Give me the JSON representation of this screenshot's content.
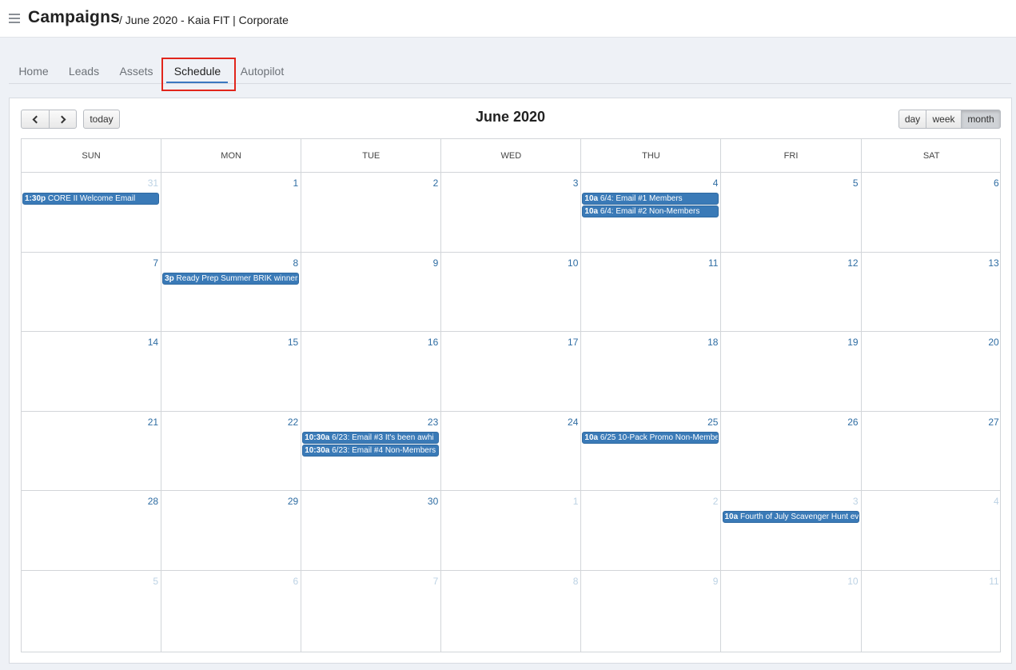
{
  "header": {
    "title": "Campaigns",
    "subtitle": "/ June 2020 - Kaia FIT | Corporate",
    "menu_icon": "hamburger-icon"
  },
  "tabs": [
    {
      "label": "Home"
    },
    {
      "label": "Leads"
    },
    {
      "label": "Assets"
    },
    {
      "label": "Schedule",
      "active": true
    },
    {
      "label": "Autopilot"
    }
  ],
  "toolbar": {
    "prev_icon": "chevron-left-icon",
    "next_icon": "chevron-right-icon",
    "today_label": "today",
    "title": "June 2020",
    "views": [
      "day",
      "week",
      "month"
    ],
    "active_view": "month"
  },
  "calendar": {
    "weekdays": [
      "SUN",
      "MON",
      "TUE",
      "WED",
      "THU",
      "FRI",
      "SAT"
    ],
    "weeks": [
      [
        {
          "day": "31",
          "other": true,
          "events": [
            {
              "time": "1:30p",
              "title": "CORE II Welcome Email"
            }
          ]
        },
        {
          "day": "1",
          "events": []
        },
        {
          "day": "2",
          "events": []
        },
        {
          "day": "3",
          "events": []
        },
        {
          "day": "4",
          "events": [
            {
              "time": "10a",
              "title": "6/4: Email #1 Members"
            },
            {
              "time": "10a",
              "title": "6/4: Email #2 Non-Members"
            }
          ]
        },
        {
          "day": "5",
          "events": []
        },
        {
          "day": "6",
          "events": []
        }
      ],
      [
        {
          "day": "7",
          "events": []
        },
        {
          "day": "8",
          "events": [
            {
              "time": "3p",
              "title": "Ready Prep Summer BRIK winners"
            }
          ]
        },
        {
          "day": "9",
          "events": []
        },
        {
          "day": "10",
          "events": []
        },
        {
          "day": "11",
          "events": []
        },
        {
          "day": "12",
          "events": []
        },
        {
          "day": "13",
          "events": []
        }
      ],
      [
        {
          "day": "14",
          "events": []
        },
        {
          "day": "15",
          "events": []
        },
        {
          "day": "16",
          "events": []
        },
        {
          "day": "17",
          "events": []
        },
        {
          "day": "18",
          "events": []
        },
        {
          "day": "19",
          "events": []
        },
        {
          "day": "20",
          "events": []
        }
      ],
      [
        {
          "day": "21",
          "events": []
        },
        {
          "day": "22",
          "events": []
        },
        {
          "day": "23",
          "events": [
            {
              "time": "10:30a",
              "title": "6/23: Email #3 It's been awhi"
            },
            {
              "time": "10:30a",
              "title": "6/23: Email #4 Non-Members"
            }
          ]
        },
        {
          "day": "24",
          "events": []
        },
        {
          "day": "25",
          "events": [
            {
              "time": "10a",
              "title": "6/25 10-Pack Promo Non-Membe"
            }
          ]
        },
        {
          "day": "26",
          "events": []
        },
        {
          "day": "27",
          "events": []
        }
      ],
      [
        {
          "day": "28",
          "events": []
        },
        {
          "day": "29",
          "events": []
        },
        {
          "day": "30",
          "events": []
        },
        {
          "day": "1",
          "other": true,
          "events": []
        },
        {
          "day": "2",
          "other": true,
          "events": []
        },
        {
          "day": "3",
          "other": true,
          "events": [
            {
              "time": "10a",
              "title": "Fourth of July Scavenger Hunt ev"
            }
          ]
        },
        {
          "day": "4",
          "other": true,
          "events": []
        }
      ],
      [
        {
          "day": "5",
          "other": true,
          "events": []
        },
        {
          "day": "6",
          "other": true,
          "events": []
        },
        {
          "day": "7",
          "other": true,
          "events": []
        },
        {
          "day": "8",
          "other": true,
          "events": []
        },
        {
          "day": "9",
          "other": true,
          "events": []
        },
        {
          "day": "10",
          "other": true,
          "events": []
        },
        {
          "day": "11",
          "other": true,
          "events": []
        }
      ]
    ]
  },
  "colors": {
    "event_bg": "#3a7ab7",
    "day_number": "#2f6da3",
    "highlight": "#e1251b",
    "tab_underline": "#3b78c0"
  }
}
